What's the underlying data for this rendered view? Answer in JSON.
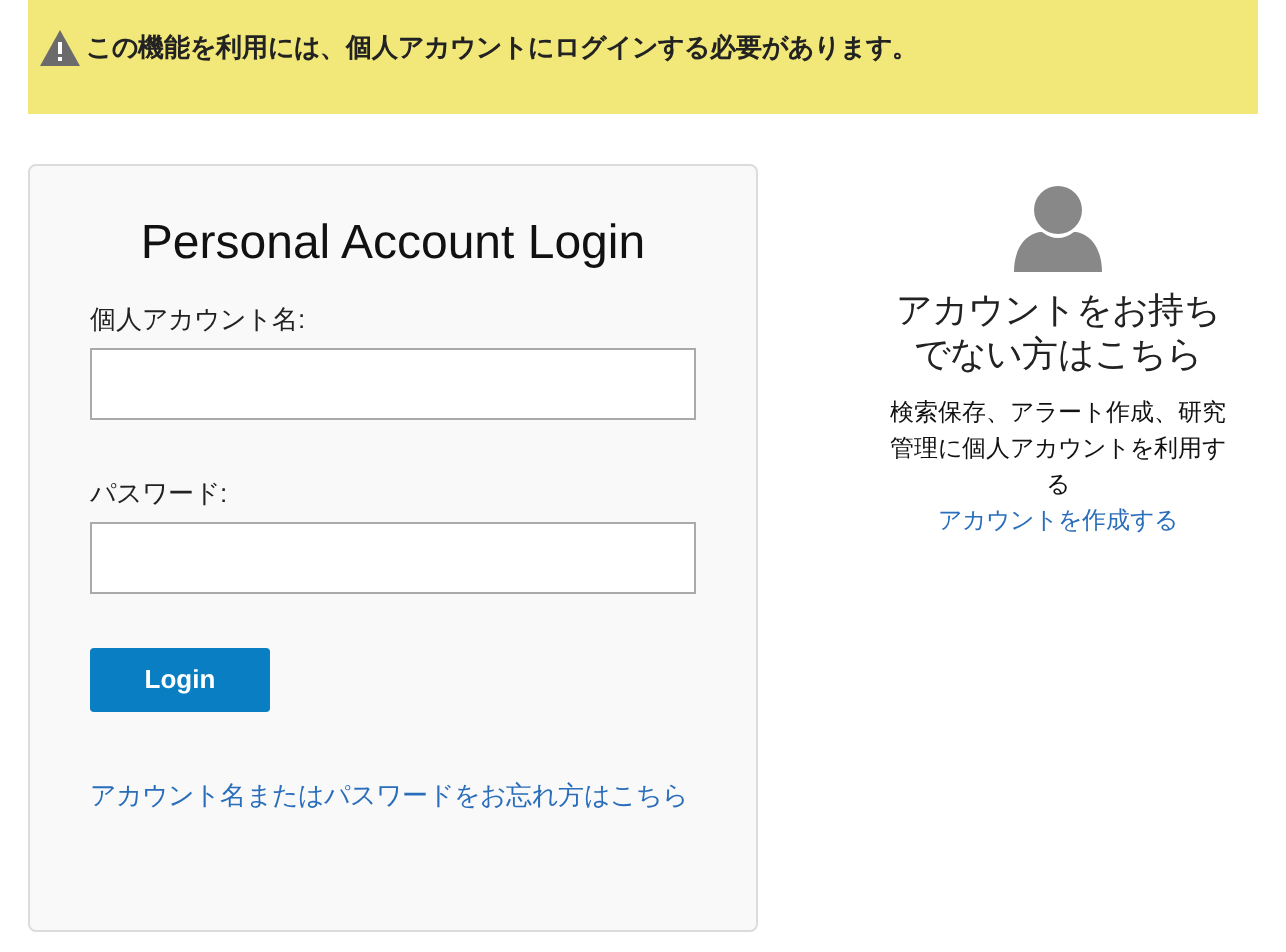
{
  "alert": {
    "message": "この機能を利用には、個人アカウントにログインする必要があります。"
  },
  "login": {
    "title": "Personal Account Login",
    "fields": [
      {
        "label": "個人アカウント名:"
      },
      {
        "label": "パスワード:"
      }
    ],
    "button": "Login",
    "forgot_link": "アカウント名またはパスワードをお忘れ方はこちら"
  },
  "signup": {
    "heading": "アカウントをお持ちでない方はこちら",
    "description": "検索保存、アラート作成、研究管理に個人アカウントを利用する",
    "link": "アカウントを作成する"
  }
}
